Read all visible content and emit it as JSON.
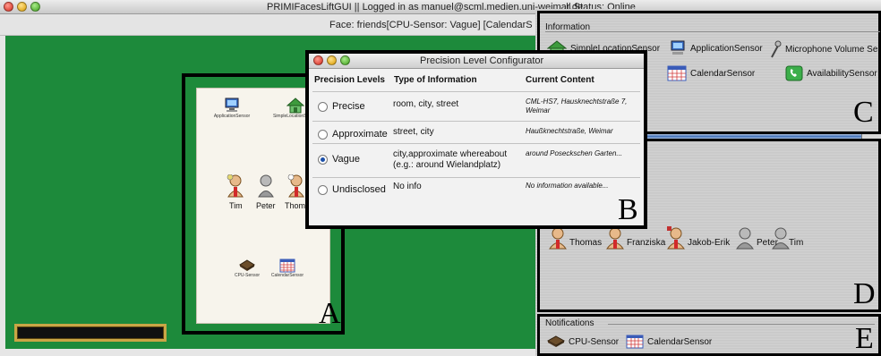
{
  "window": {
    "title": "PRIMIFacesLiftGUI || Logged in as manuel@scml.medien.uni-weimar.de",
    "status": "|| Status: Online"
  },
  "face_bar": {
    "text": "Face: friends[CPU-Sensor: Vague]  [CalendarS"
  },
  "panel_a": {
    "sensors": [
      {
        "label": "ApplicationSensor",
        "icon": "application-sensor-icon"
      },
      {
        "label": "SimpleLocationSensor",
        "icon": "house-icon"
      }
    ],
    "people": [
      "Tim",
      "Peter",
      "Thomas"
    ],
    "bottom_sensors": [
      {
        "label": "CPU-Sensor",
        "icon": "cpu-chip-icon"
      },
      {
        "label": "CalendarSensor",
        "icon": "calendar-icon"
      }
    ],
    "letter": "A"
  },
  "dialog": {
    "title": "Precision Level Configurator",
    "headers": {
      "level": "Precision Levels",
      "info": "Type of Information",
      "content": "Current Content"
    },
    "rows": [
      {
        "level": "Precise",
        "info": "room, city, street",
        "content": "CML-HS7, Hausknechtstraße 7, Weimar",
        "selected": false
      },
      {
        "level": "Approximate",
        "info": "street, city",
        "content": "Haußknechtstraße, Weimar",
        "selected": false
      },
      {
        "level": "Vague",
        "info": "city,approximate whereabout (e.g.: around Wielandplatz)",
        "content": "around Poseckschen Garten...",
        "selected": true
      },
      {
        "level": "Undisclosed",
        "info": "No info",
        "content": "No information available...",
        "selected": false
      }
    ],
    "letter": "B"
  },
  "panel_c": {
    "title": "Information",
    "sensors": [
      {
        "label": "SimpleLocationSensor",
        "icon": "house-icon"
      },
      {
        "label": "ApplicationSensor",
        "icon": "application-sensor-icon"
      },
      {
        "label": "Microphone Volume Se",
        "icon": "microphone-icon"
      },
      {
        "label": "CalendarSensor",
        "icon": "calendar-icon"
      },
      {
        "label": "AvailabilitySensor",
        "icon": "phone-icon"
      }
    ],
    "letter": "C"
  },
  "panel_d": {
    "people": [
      "Thomas",
      "Franziska",
      "Jakob-Erik",
      "Peter",
      "Tim"
    ],
    "letter": "D"
  },
  "panel_e": {
    "title": "Notifications",
    "sensors": [
      {
        "label": "CPU-Sensor",
        "icon": "cpu-chip-icon"
      },
      {
        "label": "CalendarSensor",
        "icon": "calendar-icon"
      }
    ],
    "letter": "E"
  },
  "colors": {
    "desktop_green": "#1d8a3b",
    "progress_border": "#c9a646",
    "radio_selected": "#1b4fa8",
    "scrollbar_blue": "#3f6fb8"
  }
}
